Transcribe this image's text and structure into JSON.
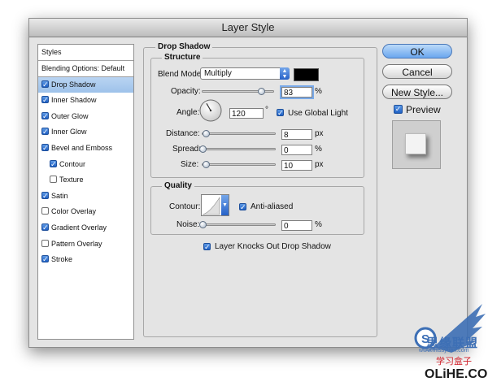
{
  "window": {
    "title": "Layer Style"
  },
  "styles_list": {
    "header": "Styles",
    "items": [
      {
        "label": "Blending Options: Default",
        "checkbox": false,
        "checked": false,
        "selected": false,
        "indent": 0
      },
      {
        "label": "Drop Shadow",
        "checkbox": true,
        "checked": true,
        "selected": true,
        "indent": 0
      },
      {
        "label": "Inner Shadow",
        "checkbox": true,
        "checked": true,
        "selected": false,
        "indent": 0
      },
      {
        "label": "Outer Glow",
        "checkbox": true,
        "checked": true,
        "selected": false,
        "indent": 0
      },
      {
        "label": "Inner Glow",
        "checkbox": true,
        "checked": true,
        "selected": false,
        "indent": 0
      },
      {
        "label": "Bevel and Emboss",
        "checkbox": true,
        "checked": true,
        "selected": false,
        "indent": 0
      },
      {
        "label": "Contour",
        "checkbox": true,
        "checked": true,
        "selected": false,
        "indent": 1
      },
      {
        "label": "Texture",
        "checkbox": true,
        "checked": false,
        "selected": false,
        "indent": 1
      },
      {
        "label": "Satin",
        "checkbox": true,
        "checked": true,
        "selected": false,
        "indent": 0
      },
      {
        "label": "Color Overlay",
        "checkbox": true,
        "checked": false,
        "selected": false,
        "indent": 0
      },
      {
        "label": "Gradient Overlay",
        "checkbox": true,
        "checked": true,
        "selected": false,
        "indent": 0
      },
      {
        "label": "Pattern Overlay",
        "checkbox": true,
        "checked": false,
        "selected": false,
        "indent": 0
      },
      {
        "label": "Stroke",
        "checkbox": true,
        "checked": true,
        "selected": false,
        "indent": 0
      }
    ]
  },
  "drop_shadow": {
    "title": "Drop Shadow",
    "structure": {
      "title": "Structure",
      "blend_mode_label": "Blend Mode:",
      "blend_mode_value": "Multiply",
      "shadow_color": "#000000",
      "opacity_label": "Opacity:",
      "opacity_value": "83",
      "opacity_percent": 83,
      "percent_unit": "%",
      "angle_label": "Angle:",
      "angle_value": "120",
      "angle_unit": "°",
      "use_global_light_label": "Use Global Light",
      "use_global_light": true,
      "distance_label": "Distance:",
      "distance_value": "8",
      "distance_fraction": 0.04,
      "px_unit": "px",
      "spread_label": "Spread:",
      "spread_value": "0",
      "spread_percent": 0,
      "size_label": "Size:",
      "size_value": "10",
      "size_fraction": 0.04
    },
    "quality": {
      "title": "Quality",
      "contour_label": "Contour:",
      "anti_aliased_label": "Anti-aliased",
      "anti_aliased": true,
      "noise_label": "Noise:",
      "noise_value": "0",
      "noise_percent": 0
    },
    "knockout_label": "Layer Knocks Out Drop Shadow",
    "knockout": true
  },
  "buttons": {
    "ok": "OK",
    "cancel": "Cancel",
    "new_style": "New Style...",
    "preview_label": "Preview",
    "preview_checked": true
  },
  "watermark": {
    "brand": "OLiHE.COM",
    "cn_text": "学习盒子",
    "cn_logo": "思缘联盟",
    "url": "www.missyuan.com"
  },
  "colors": {
    "accent": "#3a78d8",
    "selection": "#aecbf0",
    "dialog_bg": "#e4e4e4",
    "watermark_blue": "#3d6fb5",
    "watermark_red": "#d0202a"
  }
}
